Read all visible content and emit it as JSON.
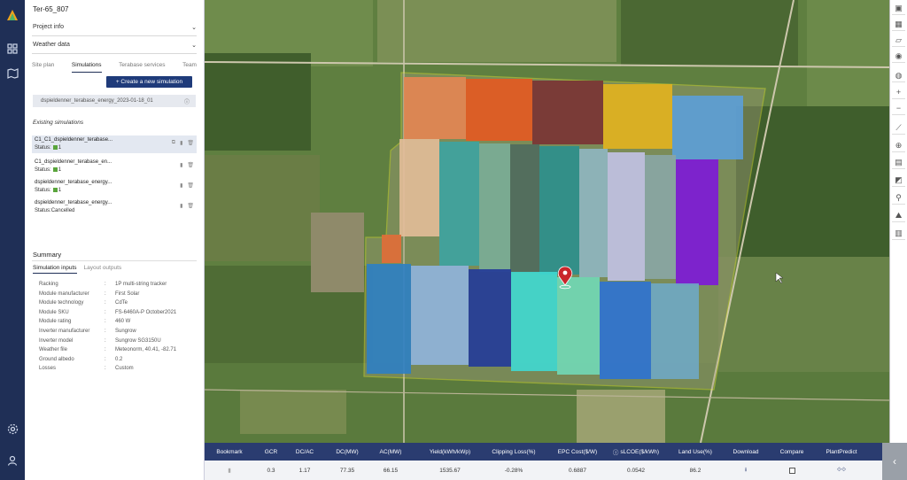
{
  "project": {
    "title": "Ter-65_807"
  },
  "accordions": [
    {
      "label": "Project info"
    },
    {
      "label": "Weather data"
    }
  ],
  "tabs": [
    {
      "label": "Site plan"
    },
    {
      "label": "Simulations"
    },
    {
      "label": "Terabase services"
    },
    {
      "label": "Team"
    }
  ],
  "actions": {
    "create_label": "+ Create a new simulation"
  },
  "selected_base": {
    "name": "dspieldenner_terabase_energy_2023-01-18_01"
  },
  "existing": {
    "heading": "Existing simulations",
    "items": [
      {
        "name": "C1_C1_dspieldenner_terabase...",
        "status_label": "Status:",
        "status_value": "1"
      },
      {
        "name": "C1_dspieldenner_terabase_en...",
        "status_label": "Status:",
        "status_value": "1"
      },
      {
        "name": "dspieldenner_terabase_energy...",
        "status_label": "Status:",
        "status_value": "1"
      },
      {
        "name": "dspieldenner_terabase_energy...",
        "status_label": "Status:",
        "status_value": "Cancelled"
      }
    ]
  },
  "summary": {
    "heading": "Summary",
    "tabs": [
      {
        "label": "Simulation inputs"
      },
      {
        "label": "Layout outputs"
      }
    ],
    "properties": [
      {
        "key": "Racking",
        "value": "1P multi-string tracker"
      },
      {
        "key": "Module manufacturer",
        "value": "First Solar"
      },
      {
        "key": "Module technology",
        "value": "CdTe"
      },
      {
        "key": "Module SKU",
        "value": "FS-6460A-P October2021"
      },
      {
        "key": "Module rating",
        "value": "460 W"
      },
      {
        "key": "Inverter manufacturer",
        "value": "Sungrow"
      },
      {
        "key": "Inverter model",
        "value": "Sungrow SG3150U"
      },
      {
        "key": "Weather file",
        "value": "Meteonorm, 40.41, -82.71"
      },
      {
        "key": "Ground albedo",
        "value": "0.2"
      },
      {
        "key": "Losses",
        "value": "Custom"
      }
    ]
  },
  "results": {
    "headers": [
      "Bookmark",
      "GCR",
      "DC/AC",
      "DC(MW)",
      "AC(MW)",
      "Yield(kWh/kWp)",
      "Clipping Loss(%)",
      "EPC Cost($/W)",
      "sLCOE($/kWh)",
      "Land Use(%)",
      "Download",
      "Compare",
      "PlantPredict"
    ],
    "row": [
      "",
      "0.3",
      "1.17",
      "77.35",
      "66.15",
      "1535.67",
      "-0.28%",
      "0.6887",
      "0.0542",
      "86.2",
      "",
      "",
      ""
    ]
  },
  "colors": {
    "nav": "#1f2f56",
    "accent": "#1f3b7a",
    "results_header": "#2a3c70"
  },
  "icons": {
    "rail": [
      "logo-icon",
      "grid-icon",
      "map-icon",
      "settings-icon",
      "user-icon"
    ],
    "toolbar": [
      "layers-icon",
      "satellite-icon",
      "draw-icon",
      "compass-icon",
      "globe-icon",
      "zoom-in-icon",
      "zoom-out-icon",
      "measure-icon",
      "world-icon",
      "kml-icon",
      "boundary-icon",
      "pin-icon",
      "terrain-icon",
      "legend-icon"
    ]
  }
}
